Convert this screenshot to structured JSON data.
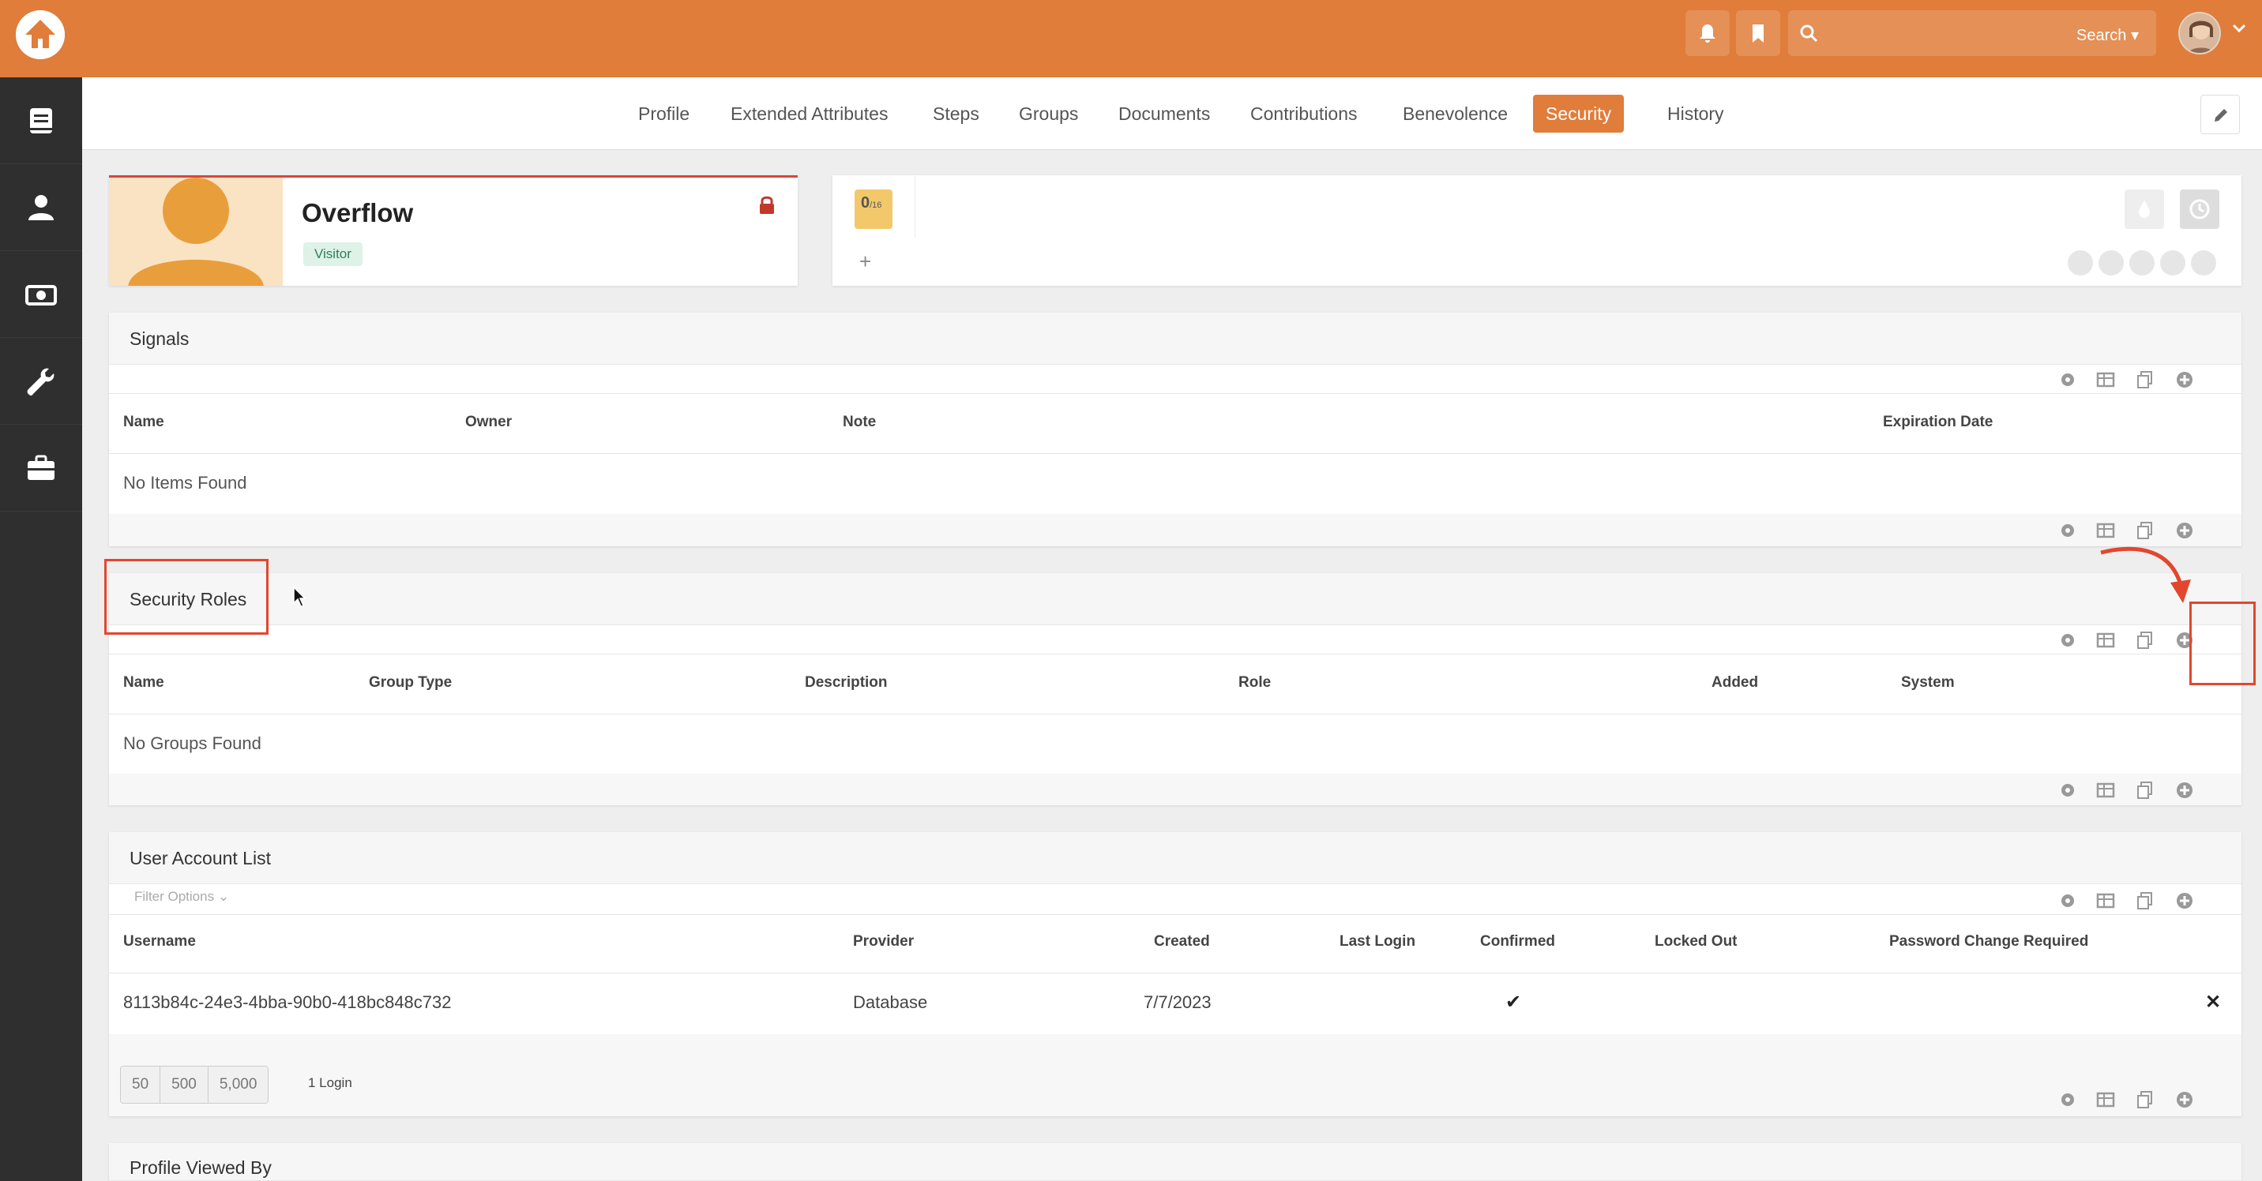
{
  "header": {
    "search_label": "Search ▾"
  },
  "tabs": [
    {
      "label": "Profile",
      "active": false
    },
    {
      "label": "Extended Attributes",
      "active": false
    },
    {
      "label": "Steps",
      "active": false
    },
    {
      "label": "Groups",
      "active": false
    },
    {
      "label": "Documents",
      "active": false
    },
    {
      "label": "Contributions",
      "active": false
    },
    {
      "label": "Benevolence",
      "active": false
    },
    {
      "label": "Security",
      "active": true
    },
    {
      "label": "History",
      "active": false
    }
  ],
  "person": {
    "name": "Overflow",
    "badge": "Visitor"
  },
  "score": {
    "value": "0",
    "denominator": "/16",
    "add_label": "+"
  },
  "signals": {
    "title": "Signals",
    "columns": [
      "Name",
      "Owner",
      "Note",
      "Expiration Date"
    ],
    "empty_text": "No Items Found"
  },
  "security_roles": {
    "title": "Security Roles",
    "columns": [
      "Name",
      "Group Type",
      "Description",
      "Role",
      "Added",
      "System"
    ],
    "empty_text": "No Groups Found"
  },
  "user_accounts": {
    "title": "User Account List",
    "filter_label": "Filter Options",
    "columns": [
      "Username",
      "Provider",
      "Created",
      "Last Login",
      "Confirmed",
      "Locked Out",
      "Password Change Required"
    ],
    "rows": [
      {
        "username": "8113b84c-24e3-4bba-90b0-418bc848c732",
        "provider": "Database",
        "created": "7/7/2023",
        "last_login": "",
        "confirmed": "✔",
        "locked_out": "",
        "password_change_required": "",
        "delete": "✕"
      }
    ],
    "page_sizes": [
      "50",
      "500",
      "5,000"
    ],
    "count_label": "1 Login"
  },
  "profile_viewed_by": {
    "title": "Profile Viewed By"
  },
  "colors": {
    "brand": "#e07d3a",
    "sidebar": "#2f2f2f",
    "annotation": "#e2462f"
  }
}
